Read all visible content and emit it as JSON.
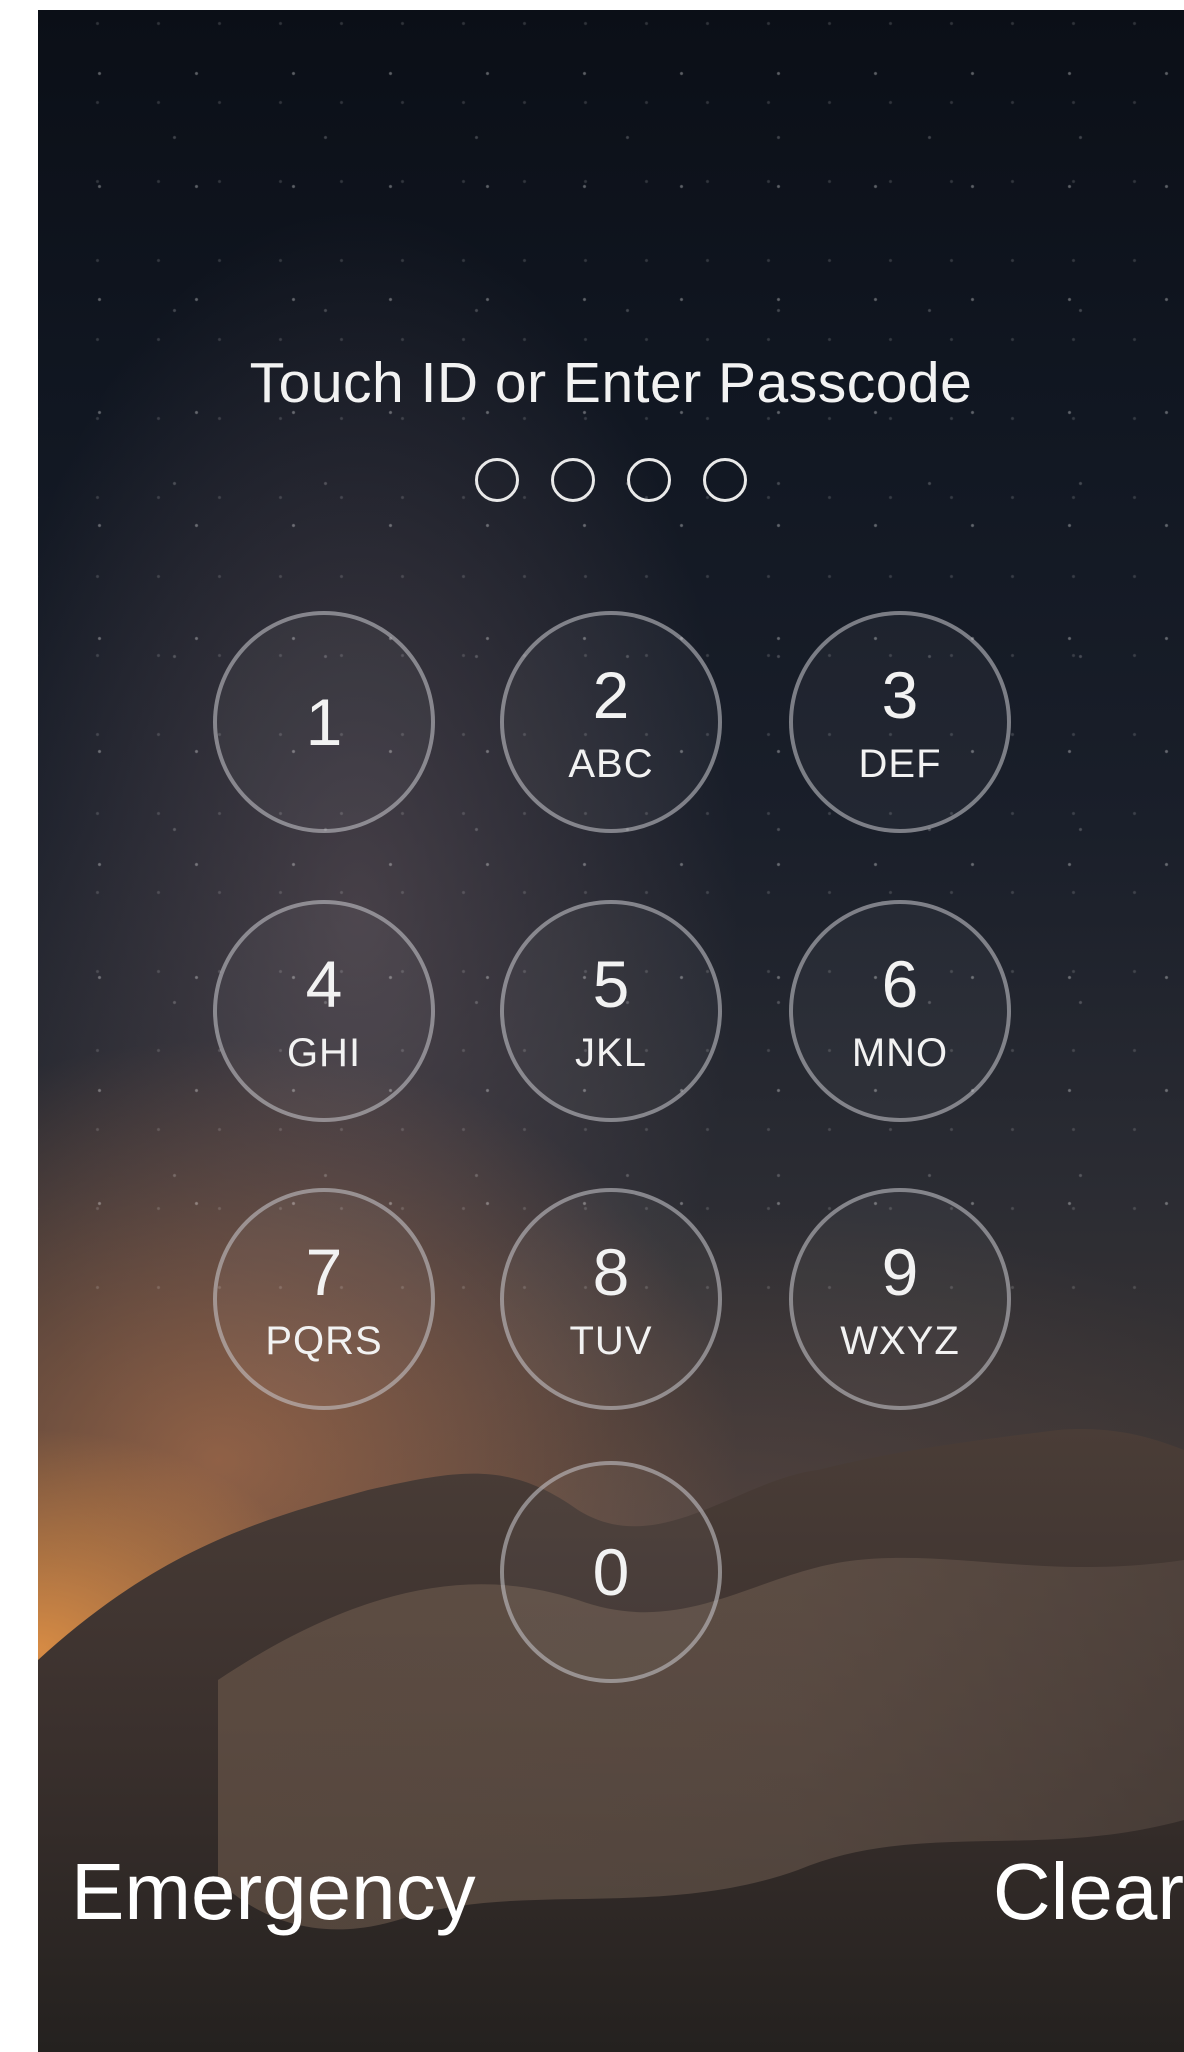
{
  "title": "Touch ID or Enter Passcode",
  "passcode": {
    "length": 4,
    "entered": 0
  },
  "keypad": [
    {
      "digit": "1",
      "letters": ""
    },
    {
      "digit": "2",
      "letters": "ABC"
    },
    {
      "digit": "3",
      "letters": "DEF"
    },
    {
      "digit": "4",
      "letters": "GHI"
    },
    {
      "digit": "5",
      "letters": "JKL"
    },
    {
      "digit": "6",
      "letters": "MNO"
    },
    {
      "digit": "7",
      "letters": "PQRS"
    },
    {
      "digit": "8",
      "letters": "TUV"
    },
    {
      "digit": "9",
      "letters": "WXYZ"
    },
    {
      "digit": "0",
      "letters": ""
    }
  ],
  "actions": {
    "emergency_label": "Emergency",
    "clear_label": "Clear"
  }
}
